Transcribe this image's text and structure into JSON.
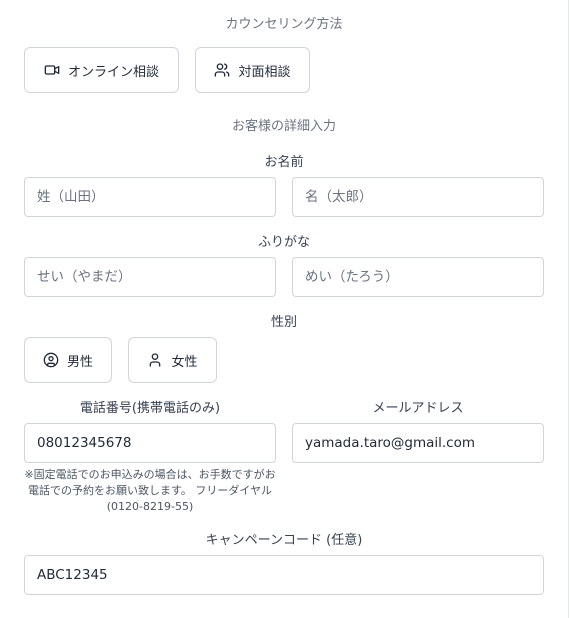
{
  "counseling": {
    "section_label": "カウンセリング方法",
    "online_label": "オンライン相談",
    "in_person_label": "対面相談"
  },
  "details": {
    "section_label": "お客様の詳細入力"
  },
  "name": {
    "label": "お名前",
    "last_placeholder": "姓（山田）",
    "first_placeholder": "名（太郎）"
  },
  "furigana": {
    "label": "ふりがな",
    "last_placeholder": "せい（やまだ）",
    "first_placeholder": "めい（たろう）"
  },
  "gender": {
    "label": "性別",
    "male_label": "男性",
    "female_label": "女性"
  },
  "phone": {
    "label": "電話番号(携帯電話のみ)",
    "value": "08012345678",
    "note": "※固定電話でのお申込みの場合は、お手数ですがお電話での予約をお願い致します。 フリーダイヤル (0120-8219-55)"
  },
  "email": {
    "label": "メールアドレス",
    "value": "yamada.taro@gmail.com"
  },
  "campaign": {
    "label": "キャンペーンコード (任意)",
    "value": "ABC12345"
  }
}
